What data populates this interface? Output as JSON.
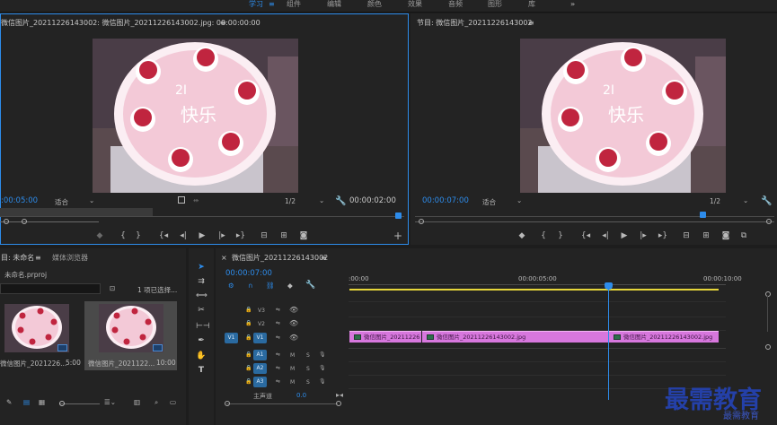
{
  "workspaces": [
    {
      "label": "学习",
      "active": true
    },
    {
      "label": "组件"
    },
    {
      "label": "编辑"
    },
    {
      "label": "颜色"
    },
    {
      "label": "效果"
    },
    {
      "label": "音频"
    },
    {
      "label": "图形"
    },
    {
      "label": "库"
    }
  ],
  "workspace_more": "»",
  "source": {
    "title": "源: 微信图片_20211226143002: 微信图片_20211226143002.jpg: 00:00:00:00",
    "title_visible": "微信图片_20211226143002: 微信图片_20211226143002.jpg: 00:00:00:00",
    "menu": "≡",
    "timecode": ":00:05:00",
    "fit": "适合",
    "resolution": "1/2",
    "duration": "00:00:02:00"
  },
  "program": {
    "title": "节目: 微信图片_20211226143002",
    "menu": "≡",
    "timecode": "00:00:07:00",
    "fit": "适合",
    "resolution": "1/2"
  },
  "cake": {
    "text_top": "2I",
    "text_main": "快乐",
    "colors": {
      "frosting": "#f3c9d7",
      "rim": "#fbeef3",
      "berry": "#c0253f",
      "bg": "#4a3d47"
    }
  },
  "project": {
    "tab_project": "目: 未命名",
    "menu": "≡",
    "tab_media": "媒体浏览器",
    "file": "未命名.prproj",
    "selection": "1 项已选择...",
    "items": [
      {
        "name": "微信图片_2021226...",
        "duration": "5:00"
      },
      {
        "name": "微信图片_2021122...",
        "duration": "10:00"
      }
    ]
  },
  "timeline": {
    "close": "×",
    "title": "微信图片_20211226143002",
    "menu": "≡",
    "timecode": "00:00:07:00",
    "ruler": [
      ":00:00",
      "00:00:05:00",
      "00:00:10:00"
    ],
    "video_tracks": [
      {
        "name": "V3"
      },
      {
        "name": "V2"
      },
      {
        "name": "V1",
        "target": "V1"
      }
    ],
    "audio_tracks": [
      {
        "name": "A1",
        "m": "M",
        "s": "S"
      },
      {
        "name": "A2",
        "m": "M",
        "s": "S"
      },
      {
        "name": "A3",
        "m": "M",
        "s": "S"
      }
    ],
    "master": {
      "label": "主声道",
      "value": "0.0"
    },
    "clips": [
      {
        "label": "微信图片_20211226"
      },
      {
        "label": "微信图片_20211226143002.jpg"
      },
      {
        "label": "微信图片_20211226143002.jpg"
      }
    ]
  },
  "watermark": {
    "title": "最需教育",
    "sub": "最需教育"
  },
  "colors": {
    "accent": "#2d8ceb",
    "clip": "#d777dd",
    "work_area": "#e6d63a",
    "track_target": "#2a6aa0"
  }
}
